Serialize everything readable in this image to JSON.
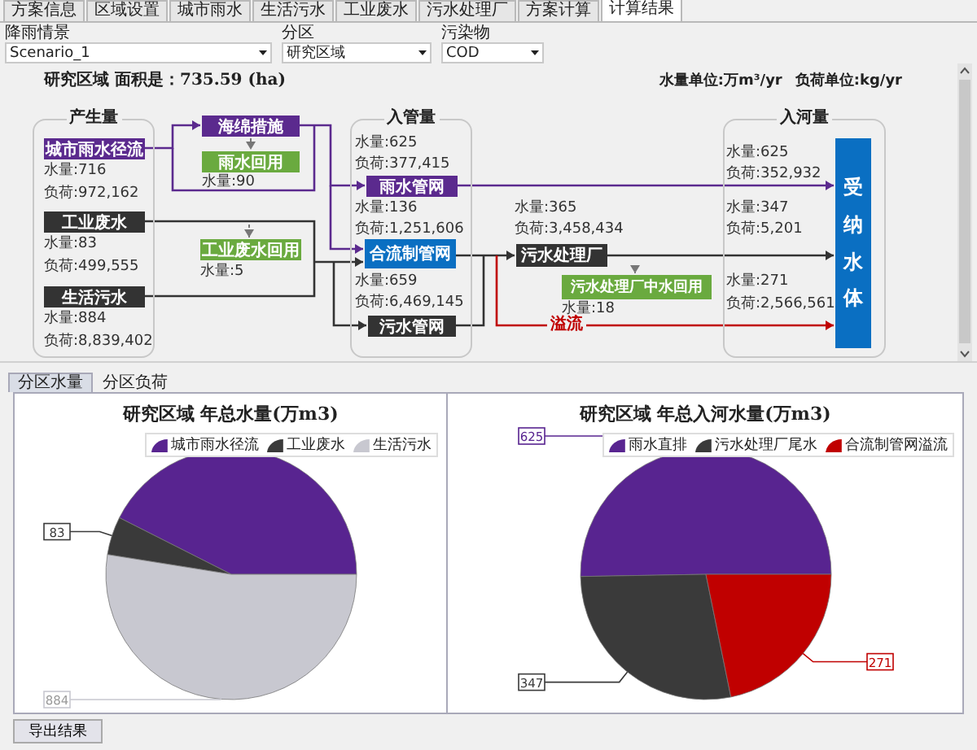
{
  "tabs": [
    {
      "label": "方案信息",
      "selected": false
    },
    {
      "label": "区域设置",
      "selected": false
    },
    {
      "label": "城市雨水",
      "selected": false
    },
    {
      "label": "生活污水",
      "selected": false
    },
    {
      "label": "工业废水",
      "selected": false
    },
    {
      "label": "污水处理厂",
      "selected": false
    },
    {
      "label": "方案计算",
      "selected": false
    },
    {
      "label": "计算结果",
      "selected": true
    }
  ],
  "filters": [
    {
      "label": "降雨情景",
      "value": "Scenario_1"
    },
    {
      "label": "分区",
      "value": "研究区域"
    },
    {
      "label": "污染物",
      "value": "COD"
    }
  ],
  "diagram": {
    "area_title": "研究区域 面积是：735.59 (ha)",
    "units": [
      "水量单位:万m³/yr",
      "负荷单位:kg/yr"
    ],
    "groups": [
      "产生量",
      "入管量",
      "入河量"
    ],
    "nodes": [
      {
        "label": "城市雨水径流",
        "kind": "rain"
      },
      {
        "label": "工业废水",
        "kind": "dark"
      },
      {
        "label": "生活污水",
        "kind": "dark"
      },
      {
        "label": "海绵措施",
        "kind": "rain"
      },
      {
        "label": "雨水回用",
        "kind": "reuse"
      },
      {
        "label": "工业废水回用",
        "kind": "reuse"
      },
      {
        "label": "雨水管网",
        "kind": "rain"
      },
      {
        "label": "合流制管网",
        "kind": "combined"
      },
      {
        "label": "污水管网",
        "kind": "dark"
      },
      {
        "label": "污水处理厂",
        "kind": "dark"
      },
      {
        "label": "污水处理厂中水回用",
        "kind": "reuse"
      }
    ],
    "readings": [
      "水量:716",
      "负荷:972,162",
      "水量:83",
      "负荷:499,555",
      "水量:884",
      "负荷:8,839,402",
      "水量:90",
      "水量:5",
      "水量:625",
      "负荷:377,415",
      "水量:136",
      "负荷:1,251,606",
      "水量:659",
      "负荷:6,469,145",
      "水量:365",
      "负荷:3,458,434",
      "水量:18",
      "水量:625",
      "负荷:352,932",
      "水量:347",
      "负荷:5,201",
      "水量:271",
      "负荷:2,566,561"
    ],
    "overflow_label": "溢流",
    "receiving_water": "受纳水体"
  },
  "result_tabs": [
    {
      "label": "分区水量",
      "selected": true
    },
    {
      "label": "分区负荷",
      "selected": false
    }
  ],
  "charts": [
    {
      "chart_data": {
        "type": "pie",
        "title": "研究区域 年总水量(万m3)",
        "categories": [
          "城市雨水径流",
          "工业废水",
          "生活污水"
        ],
        "values": [
          716,
          83,
          884
        ],
        "value_labels": [
          null,
          "83",
          "884"
        ],
        "legend": true
      }
    },
    {
      "chart_data": {
        "type": "pie",
        "title": "研究区域 年总入河水量(万m3)",
        "categories": [
          "雨水直排",
          "污水处理厂尾水",
          "合流制管网溢流"
        ],
        "values": [
          625,
          347,
          271
        ],
        "value_labels": [
          "625",
          "347",
          "271"
        ],
        "legend": true
      }
    }
  ],
  "export_button": "导出结果"
}
